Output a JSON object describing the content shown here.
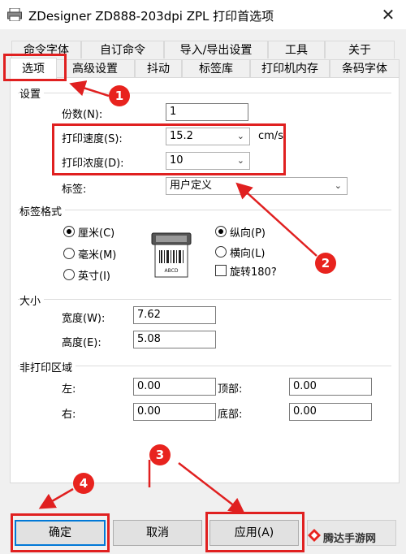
{
  "window": {
    "title": "ZDesigner ZD888-203dpi ZPL 打印首选项",
    "close": "✕"
  },
  "tabs_row1": [
    "命令字体",
    "自订命令",
    "导入/导出设置",
    "工具",
    "关于"
  ],
  "tabs_row2": [
    "选项",
    "高级设置",
    "抖动",
    "标签库",
    "打印机内存",
    "条码字体"
  ],
  "settings": {
    "group": "设置",
    "copies_label": "份数(N):",
    "copies_value": "1",
    "speed_label": "打印速度(S):",
    "speed_value": "15.2",
    "speed_unit": "cm/s",
    "darkness_label": "打印浓度(D):",
    "darkness_value": "10",
    "label_label": "标签:",
    "label_value": "用户定义"
  },
  "label_format": {
    "group": "标签格式",
    "units": [
      {
        "label": "厘米(C)",
        "checked": true
      },
      {
        "label": "毫米(M)",
        "checked": false
      },
      {
        "label": "英寸(I)",
        "checked": false
      }
    ],
    "orientation": [
      {
        "label": "纵向(P)",
        "checked": true
      },
      {
        "label": "横向(L)",
        "checked": false
      }
    ],
    "rotate_label": "旋转180?",
    "rotate_checked": false,
    "preview_text": "ABCD"
  },
  "size": {
    "group": "大小",
    "width_label": "宽度(W):",
    "width_value": "7.62",
    "height_label": "高度(E):",
    "height_value": "5.08"
  },
  "nonprint": {
    "group": "非打印区域",
    "left_label": "左:",
    "left_value": "0.00",
    "top_label": "顶部:",
    "top_value": "0.00",
    "right_label": "右:",
    "right_value": "0.00",
    "bottom_label": "底部:",
    "bottom_value": "0.00"
  },
  "buttons": {
    "ok": "确定",
    "cancel": "取消",
    "apply": "应用(A)"
  },
  "annotations": {
    "badge1": "1",
    "badge2": "2",
    "badge3": "3",
    "badge4": "4",
    "color": "#e02020"
  },
  "watermark": "腾达手游网"
}
